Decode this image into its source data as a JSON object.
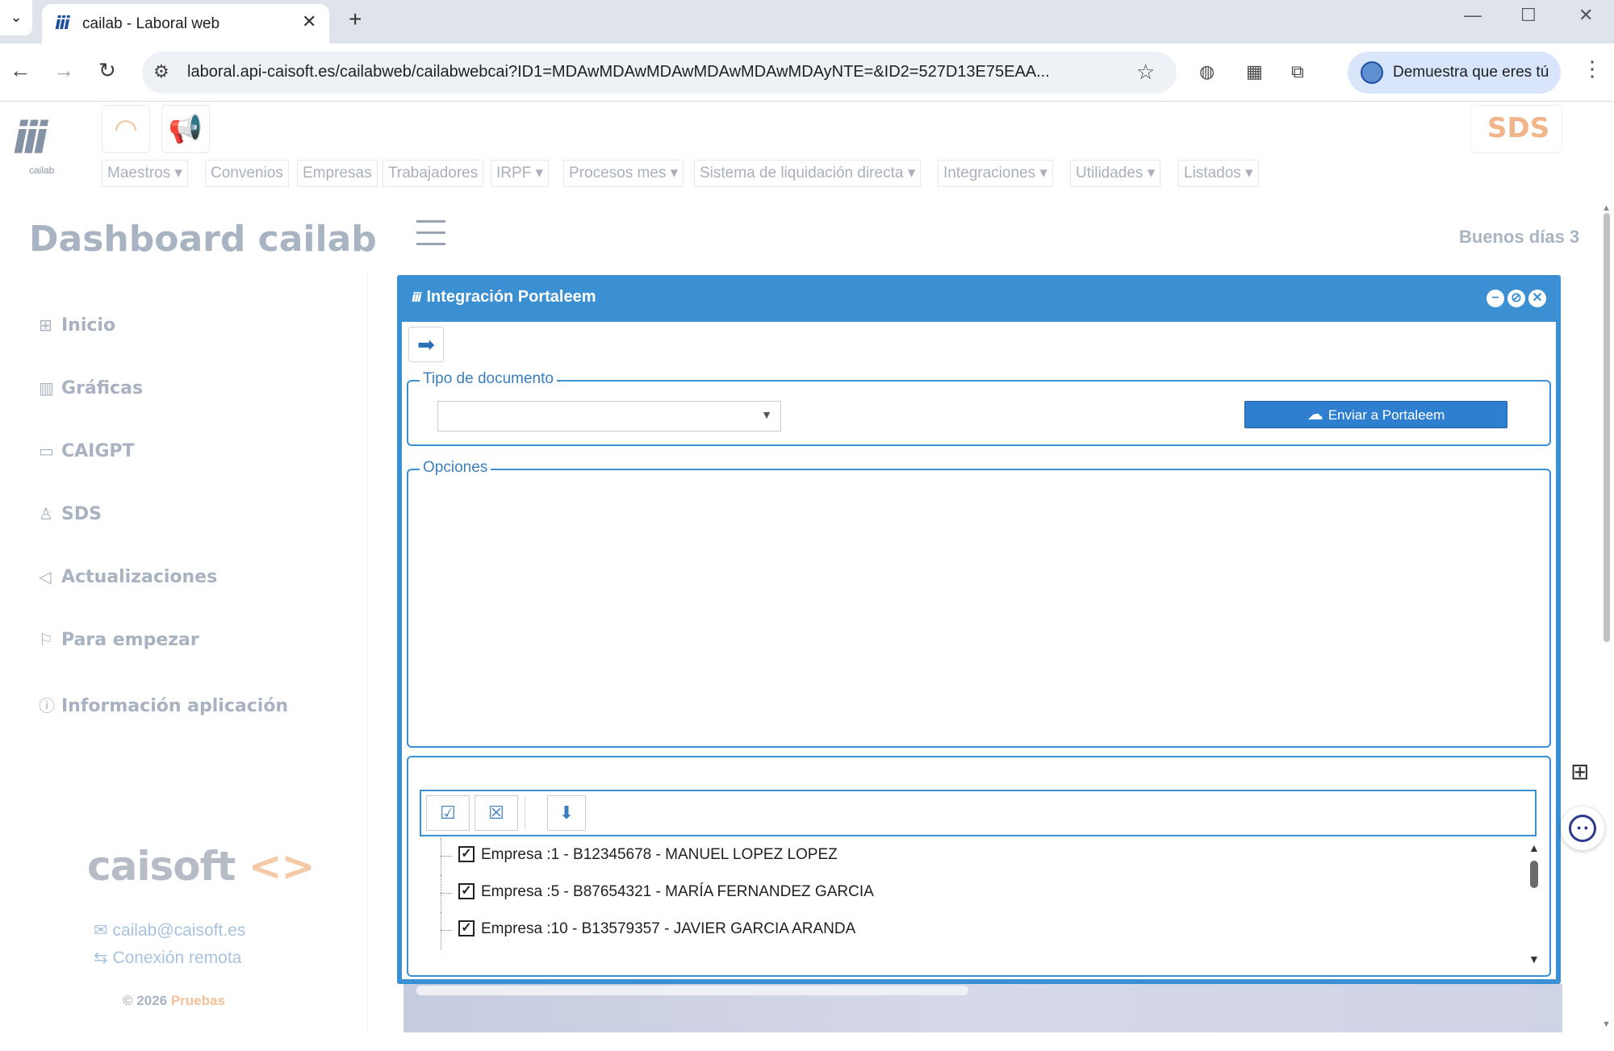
{
  "browser": {
    "tab_title": "cailab - Laboral web",
    "tab_favicon": "iii",
    "url": "laboral.api-caisoft.es/cailabweb/cailabwebcai?ID1=MDAwMDAwMDAwMDAwMDAwMDAyNTE=&ID2=527D13E75EAA...",
    "profile_label": "Demuestra que eres tú"
  },
  "app": {
    "logo_text": "iii",
    "logo_sub": "cailab",
    "sds_label": "SDS",
    "menu": [
      "Maestros",
      "Convenios",
      "Empresas",
      "Trabajadores",
      "IRPF",
      "Procesos mes",
      "Sistema de liquidación directa",
      "Integraciones",
      "Utilidades",
      "Listados"
    ],
    "dashboard_title": "Dashboard cailab",
    "greeting": "Buenos días 3"
  },
  "sidebar": {
    "items": [
      {
        "icon": "grid-icon",
        "label": "Inicio"
      },
      {
        "icon": "bar-chart-icon",
        "label": "Gráficas"
      },
      {
        "icon": "chat-icon",
        "label": "CAIGPT"
      },
      {
        "icon": "user-icon",
        "label": "SDS"
      },
      {
        "icon": "megaphone-icon",
        "label": "Actualizaciones"
      },
      {
        "icon": "flag-icon",
        "label": "Para empezar"
      },
      {
        "icon": "info-icon",
        "label": "Información aplicación"
      }
    ],
    "brand": "caisoft",
    "email": "cailab@caisoft.es",
    "remote": "Conexión remota",
    "copyright": "© 2026",
    "copyright_accent": "Pruebas"
  },
  "modal": {
    "title": "Integración Portaleem",
    "doc_type_legend": "Tipo de documento",
    "doc_type_value": "",
    "send_button": "Enviar a Portaleem",
    "options_legend": "Opciones",
    "companies": [
      {
        "label": "Empresa :1 - B12345678 - MANUEL LOPEZ LOPEZ",
        "checked": true
      },
      {
        "label": "Empresa :5 - B87654321 - MARÍA FERNANDEZ GARCIA",
        "checked": true
      },
      {
        "label": "Empresa :10 - B13579357 - JAVIER GARCIA ARANDA",
        "checked": true
      }
    ]
  },
  "colors": {
    "modal_blue": "#3b8fd3",
    "button_blue": "#2f7fd0",
    "muted_text": "#a9b4c2"
  }
}
